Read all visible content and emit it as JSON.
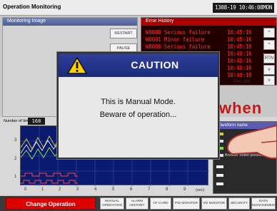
{
  "window": {
    "title": "Operation Monitoring",
    "clock": "1308-19 10:46:08MON"
  },
  "monitoring": {
    "header": "Monitoring Image",
    "buttons": [
      "RESTART",
      "PAUSE"
    ]
  },
  "error_history": {
    "header": "Error History",
    "rows": [
      {
        "code": "W0000 Serious failure",
        "time": "10:45:16"
      },
      {
        "code": "W0001 Minor failure",
        "time": "10:45:16"
      },
      {
        "code": "W0006 Serious failure",
        "time": "10:45:16"
      },
      {
        "code": "",
        "time": "10:40:16"
      },
      {
        "code": "",
        "time": "10:40:16"
      },
      {
        "code": "",
        "time": "10:40:16"
      },
      {
        "code": "",
        "time": "10:40:16"
      }
    ],
    "side_buttons": [
      "^",
      "^",
      "RTN",
      "v",
      "v"
    ],
    "extra_labels": [
      "ET",
      "FAILURE"
    ]
  },
  "graph": {
    "count_label": "Number of times",
    "count_value": "168",
    "x_ticks": [
      "0",
      "1",
      "2",
      "3",
      "4",
      "5",
      "6",
      "7",
      "8",
      "9"
    ],
    "x_unit": "(sec)",
    "y_ticks": [
      "3",
      "2",
      "1"
    ]
  },
  "legend": {
    "title": "Waveform name",
    "items": [
      {
        "label": "",
        "color": "#cccc44"
      },
      {
        "label": "",
        "color": "#dddddd"
      },
      {
        "label": "",
        "color": "#88dd44"
      },
      {
        "label": "",
        "color": "#ff4444"
      },
      {
        "label": "Booster outlet pressure",
        "color": "#dddddd"
      },
      {
        "label": "",
        "color": "#eeeeee"
      },
      {
        "label": "",
        "color": "#eeeeee"
      },
      {
        "label": "",
        "color": "#eeeeee"
      }
    ]
  },
  "footer": {
    "change_operation": "Change Operation",
    "buttons": [
      {
        "line1": "MANUAL",
        "line2": "OPERATION"
      },
      {
        "line1": "ALARM",
        "line2": "HISTORY"
      },
      {
        "line1": "CF CARD",
        "line2": ""
      },
      {
        "line1": "PID MONITOR",
        "line2": ""
      },
      {
        "line1": "I/O MONITOR",
        "line2": ""
      },
      {
        "line1": "SECURITY",
        "line2": ""
      },
      {
        "line1": "DATA",
        "line2": "MANAGEMENT"
      }
    ]
  },
  "caution": {
    "title": "CAUTION",
    "line1": "This is Manual Mode.",
    "line2": "Beware of operation..."
  },
  "decoration": {
    "text": "when"
  }
}
